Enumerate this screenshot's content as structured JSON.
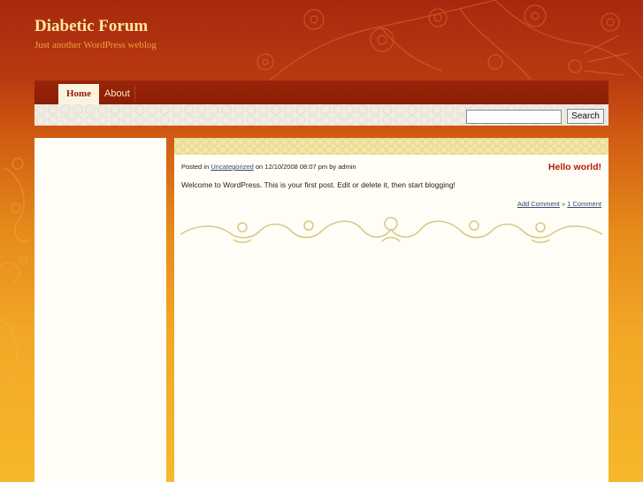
{
  "site": {
    "title": "Diabetic Forum",
    "description": "Just another WordPress weblog"
  },
  "nav": {
    "items": [
      {
        "label": "Home",
        "active": true
      },
      {
        "label": "About",
        "active": false
      }
    ]
  },
  "search": {
    "value": "",
    "button_label": "Search"
  },
  "post": {
    "title": "Hello world!",
    "meta_prefix": "Posted in",
    "category": "Uncategorized",
    "meta_suffix": "on 12/10/2008 08:07 pm by admin",
    "body": "Welcome to WordPress. This is your first post. Edit or delete it, then start blogging!",
    "add_comment_label": "Add Comment",
    "separator": "»",
    "comments_label": "1 Comment"
  },
  "colors": {
    "header_red": "#a8280e",
    "background_orange": "#f6b82c",
    "title_gold": "#ffe8a0",
    "post_title_red": "#b21a05",
    "content_bg": "#fffdf6"
  },
  "icons": {
    "header_decoration": "plum-blossom-branch-ornament",
    "side_decoration": "floral-swirl-ornament",
    "post_divider": "scroll-flourish-divider"
  }
}
